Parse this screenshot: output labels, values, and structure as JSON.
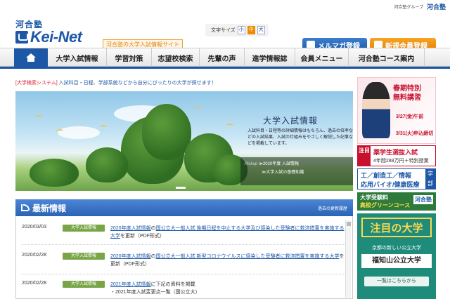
{
  "topbar": {
    "group_text": "河合塾グループ",
    "group_logo": "河合塾"
  },
  "header": {
    "kawai": "河合塾",
    "logo": "Kei-Net",
    "tagline": "河合塾の大学入試情報サイト",
    "font_size_label": "文字サイズ",
    "font_sizes": [
      "小",
      "中",
      "大"
    ],
    "mail_button": "メルマガ登録",
    "register_button": "新規会員登録"
  },
  "nav": {
    "items": [
      "大学入試情報",
      "学習対策",
      "志望校検索",
      "先輩の声",
      "進学情報誌",
      "会員メニュー",
      "河合塾コース案内"
    ]
  },
  "notice": {
    "tag": "[大学検索システム]",
    "text": "入試科目・日程、学部系統などから自分にぴったりの大学が探せます！"
  },
  "hero": {
    "title": "大学入試情報",
    "description": "入試科目・日程等の詳細情報はもちろん、過去の倍率などの入試結果、入試の仕組みをやさしく解説した記事などを掲載しています。",
    "pickup_tag": "Pickup",
    "pickup_1": "≫2020年度 入試情報",
    "pickup_2": "≫大学入試の基礎知識"
  },
  "news": {
    "heading": "最新情報",
    "past_link": "過去の更新履歴",
    "items": [
      {
        "date": "2020/03/03",
        "badge": "大学入試情報",
        "link": "2020年度入試情報",
        "text1": "の",
        "link2": "国公立大一般入試 後期日程を中止する大学及び感染した受験者に救済措置を実施する大学",
        "text2": "を更新（PDF形式）"
      },
      {
        "date": "2020/02/28",
        "badge": "大学入試情報",
        "link": "2020年度入試情報",
        "text1": "の",
        "link2": "国公立大一般入試 新型コロナウイルスに感染した受験者に救済措置を実施する大学",
        "text2": "を更新（PDF形式）"
      },
      {
        "date": "2020/02/28",
        "badge": "大学入試情報",
        "link": "2021年度入試情報",
        "text1": "に下記の資料を掲載",
        "link2": "・2021年度入試変更点一覧（国公立大）",
        "text2": ""
      }
    ]
  },
  "sidebar": {
    "ad1_t1": "春期特別",
    "ad1_t2": "無料講習",
    "ad1_d1": "3/27(金)午前",
    "ad1_d2": "3/31(火)申込締切",
    "ad2_a": "注目",
    "ad2_b": "薬学生選抜入試",
    "ad2_c": "4年間288万円＋特別授業",
    "ad3_a": "工／創造工／情報",
    "ad3_b": "応用バイオ/健康医療",
    "ad3_c": "学部",
    "ad4_a": "大学受験料",
    "ad4_b": "高校グリーンコース",
    "ad4_c": "河合塾",
    "ad5_a": "注目の大学",
    "ad5_b": "京都の新しい公立大学",
    "ad5_c": "福知山公立大学",
    "ad5_d": "一覧はこちらから"
  }
}
